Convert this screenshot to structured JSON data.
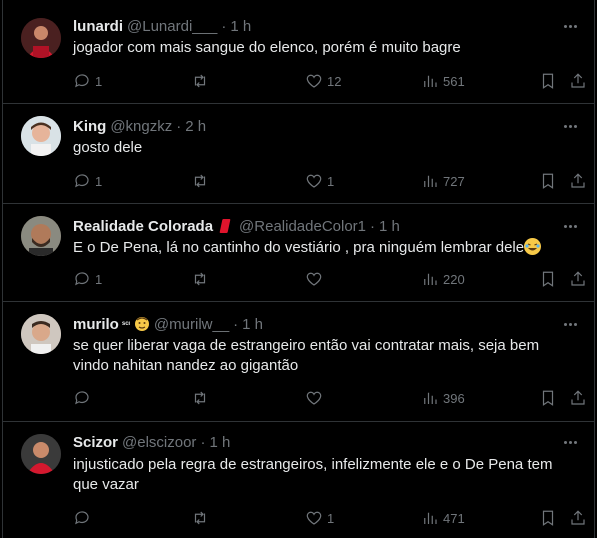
{
  "tweets": [
    {
      "name": "lunardi",
      "handle": "@Lunardi___",
      "time": "1 h",
      "text": "jogador com mais sangue do elenco, porém é muito bagre",
      "replies": "1",
      "retweets": "",
      "likes": "12",
      "views": "561"
    },
    {
      "name": "King",
      "handle": "@kngzkz",
      "time": "2 h",
      "text": "gosto dele",
      "replies": "1",
      "retweets": "",
      "likes": "1",
      "views": "727"
    },
    {
      "name": "Realidade Colorada",
      "handle": "@RealidadeColor1",
      "time": "1 h",
      "text": "E o De Pena, lá no cantinho do vestiário , pra ninguém lembrar dele",
      "replies": "1",
      "retweets": "",
      "likes": "",
      "views": "220"
    },
    {
      "name": "murilo",
      "name_suffix": "ˢᶜᶦ",
      "handle": "@murilw__",
      "time": "1 h",
      "text": "se quer liberar vaga de estrangeiro então vai contratar mais, seja bem vindo nahitan nandez ao gigantão",
      "replies": "",
      "retweets": "",
      "likes": "",
      "views": "396"
    },
    {
      "name": "Scizor",
      "handle": "@elscizoor",
      "time": "1 h",
      "text": "injusticado pela regra de estrangeiros, infelizmente ele e o De Pena tem que vazar",
      "replies": "",
      "retweets": "",
      "likes": "1",
      "views": "471"
    }
  ],
  "separator": "·",
  "colors": {
    "background": "#000000",
    "text": "#e7e9ea",
    "muted": "#71767b",
    "divider": "#2f3336",
    "brand_badge": "#e0142c"
  }
}
